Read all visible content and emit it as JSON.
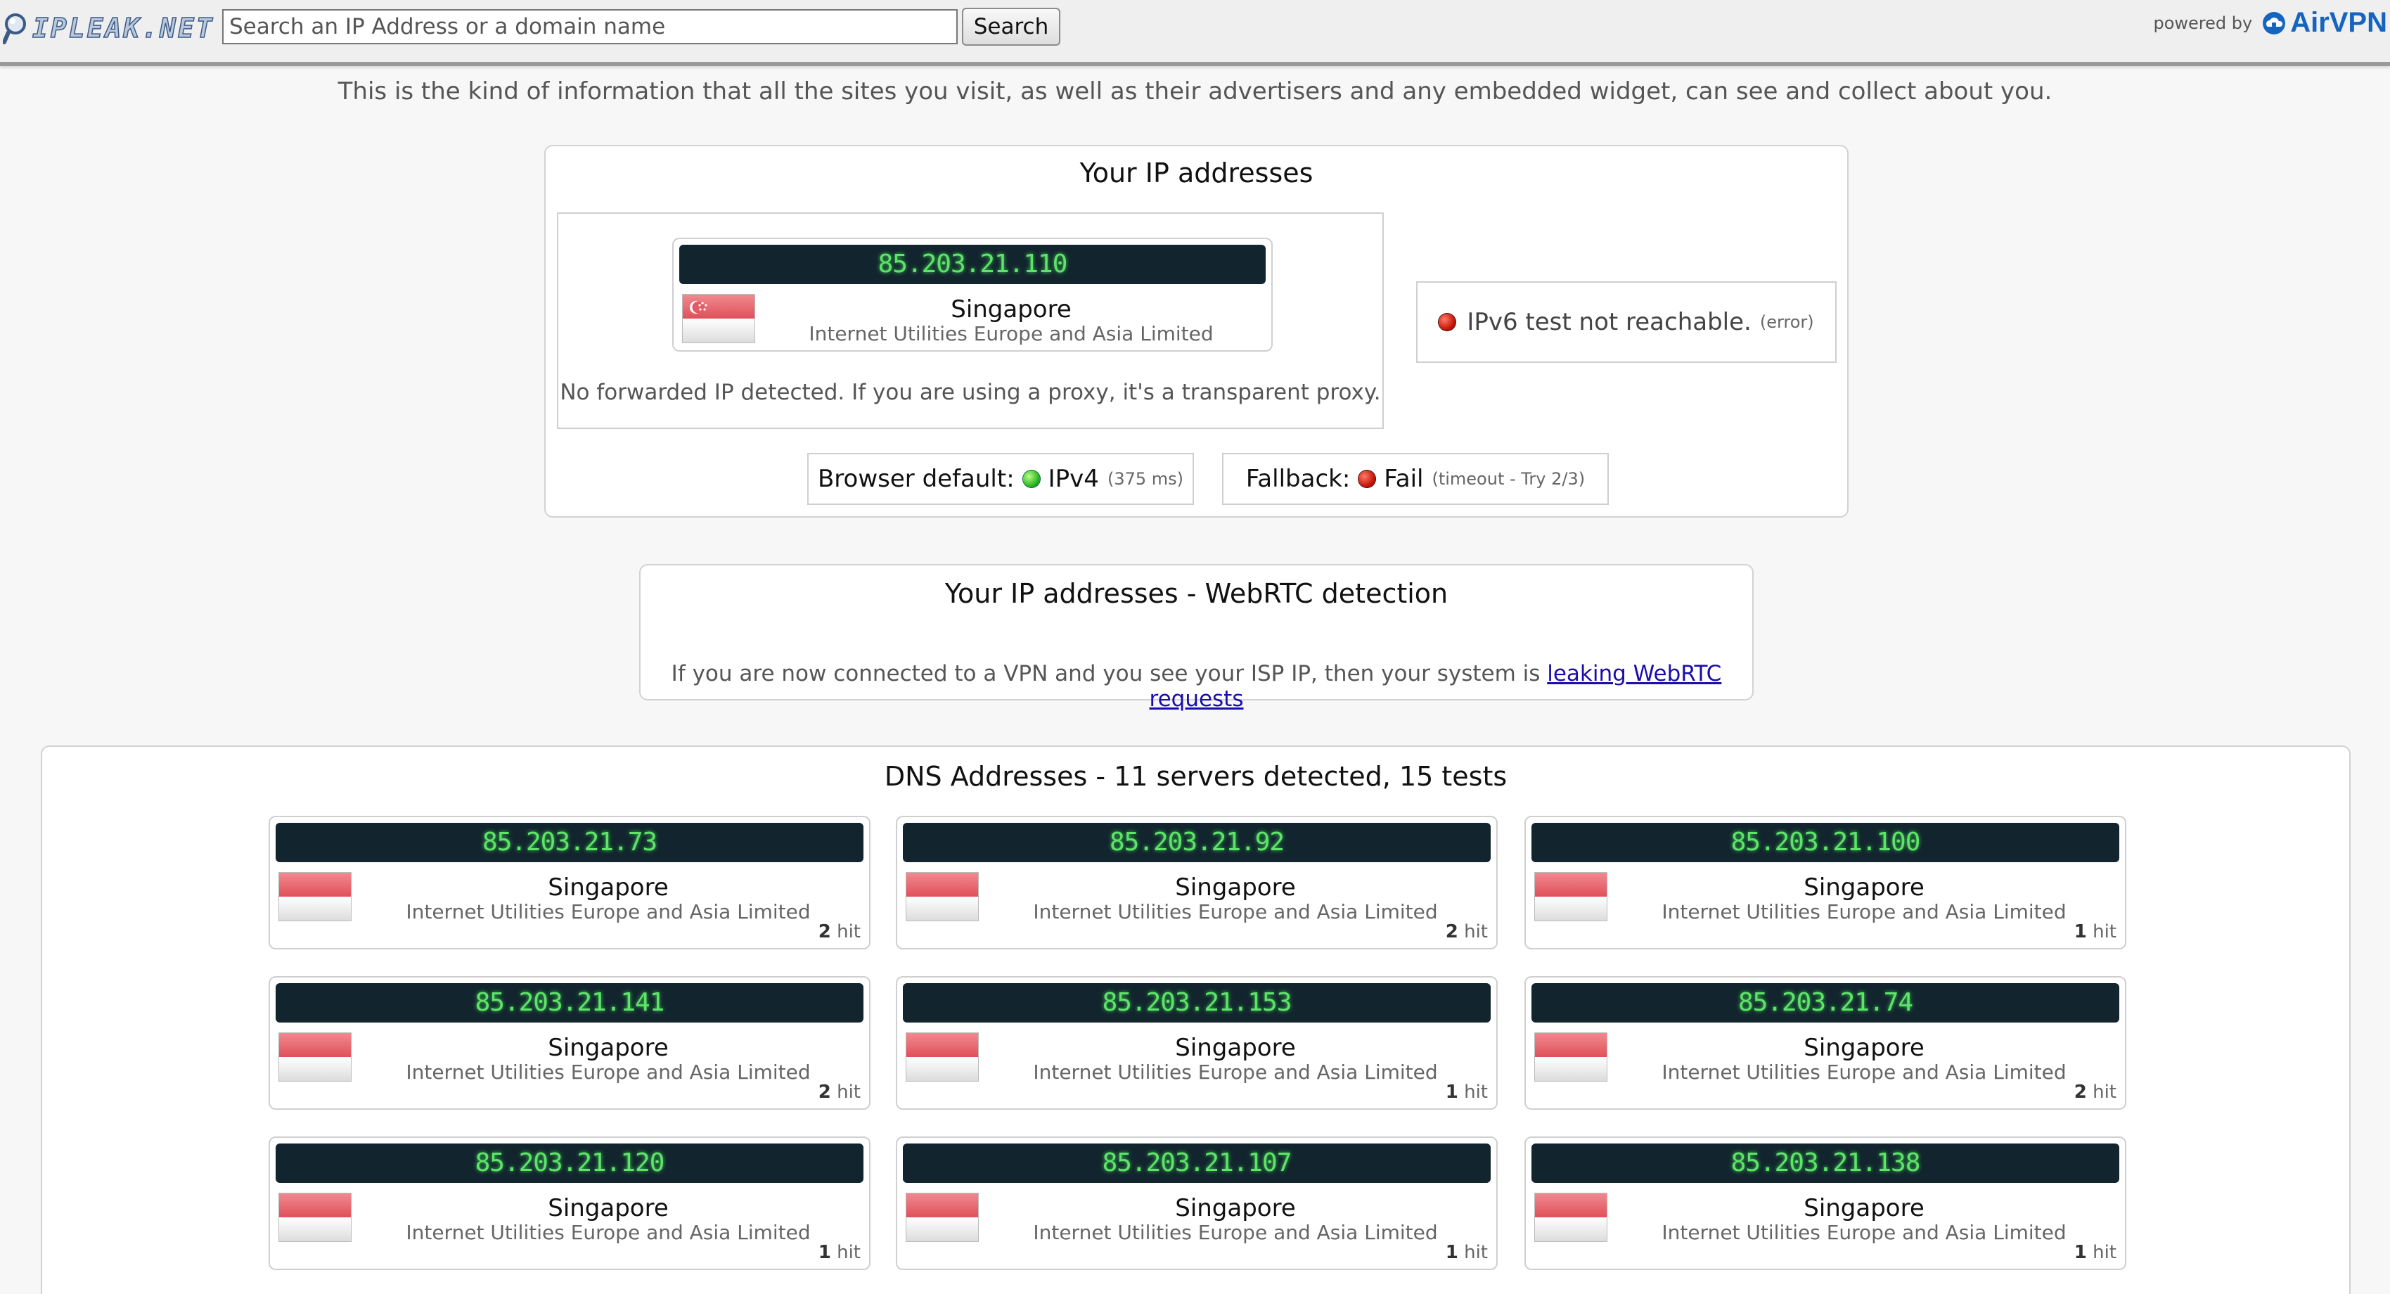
{
  "header": {
    "logo_text": "IPLEAK.NET",
    "search_placeholder": "Search an IP Address or a domain name",
    "search_value": "",
    "search_button": "Search",
    "powered_by": "powered by",
    "airvpn": "AirVPN"
  },
  "intro": "This is the kind of information that all the sites you visit, as well as their advertisers and any embedded widget, can see and collect about you.",
  "ip_panel": {
    "title": "Your IP addresses",
    "ipv4": {
      "ip": "85.203.21.110",
      "country": "Singapore",
      "isp": "Internet Utilities Europe and Asia Limited"
    },
    "forwarded_note": "No forwarded IP detected. If you are using a proxy, it's a transparent proxy.",
    "ipv6": {
      "label": "IPv6 test not reachable.",
      "detail": "(error)"
    },
    "browser_default": {
      "label": "Browser default:",
      "value": "IPv4",
      "detail": "(375 ms)"
    },
    "fallback": {
      "label": "Fallback:",
      "value": "Fail",
      "detail": "(timeout - Try 2/3)"
    }
  },
  "webrtc": {
    "title": "Your IP addresses - WebRTC detection",
    "note": "If you are now connected to a VPN and you see your ISP IP, then your system is",
    "link": "leaking WebRTC requests"
  },
  "dns": {
    "title": "DNS Addresses - 11 servers detected, 15 tests",
    "hit_word": "hit",
    "servers": [
      {
        "ip": "85.203.21.73",
        "country": "Singapore",
        "isp": "Internet Utilities Europe and Asia Limited",
        "hits": "2"
      },
      {
        "ip": "85.203.21.92",
        "country": "Singapore",
        "isp": "Internet Utilities Europe and Asia Limited",
        "hits": "2"
      },
      {
        "ip": "85.203.21.100",
        "country": "Singapore",
        "isp": "Internet Utilities Europe and Asia Limited",
        "hits": "1"
      },
      {
        "ip": "85.203.21.141",
        "country": "Singapore",
        "isp": "Internet Utilities Europe and Asia Limited",
        "hits": "2"
      },
      {
        "ip": "85.203.21.153",
        "country": "Singapore",
        "isp": "Internet Utilities Europe and Asia Limited",
        "hits": "1"
      },
      {
        "ip": "85.203.21.74",
        "country": "Singapore",
        "isp": "Internet Utilities Europe and Asia Limited",
        "hits": "2"
      },
      {
        "ip": "85.203.21.120",
        "country": "Singapore",
        "isp": "Internet Utilities Europe and Asia Limited",
        "hits": "1"
      },
      {
        "ip": "85.203.21.107",
        "country": "Singapore",
        "isp": "Internet Utilities Europe and Asia Limited",
        "hits": "1"
      },
      {
        "ip": "85.203.21.138",
        "country": "Singapore",
        "isp": "Internet Utilities Europe and Asia Limited",
        "hits": "1"
      }
    ]
  },
  "colors": {
    "ip_bar_bg": "#12252e",
    "ip_text": "#5fe36a",
    "status_ok": "#2fb82a",
    "status_fail": "#c81808",
    "link": "#1a0dab",
    "brand": "#1565c0"
  }
}
